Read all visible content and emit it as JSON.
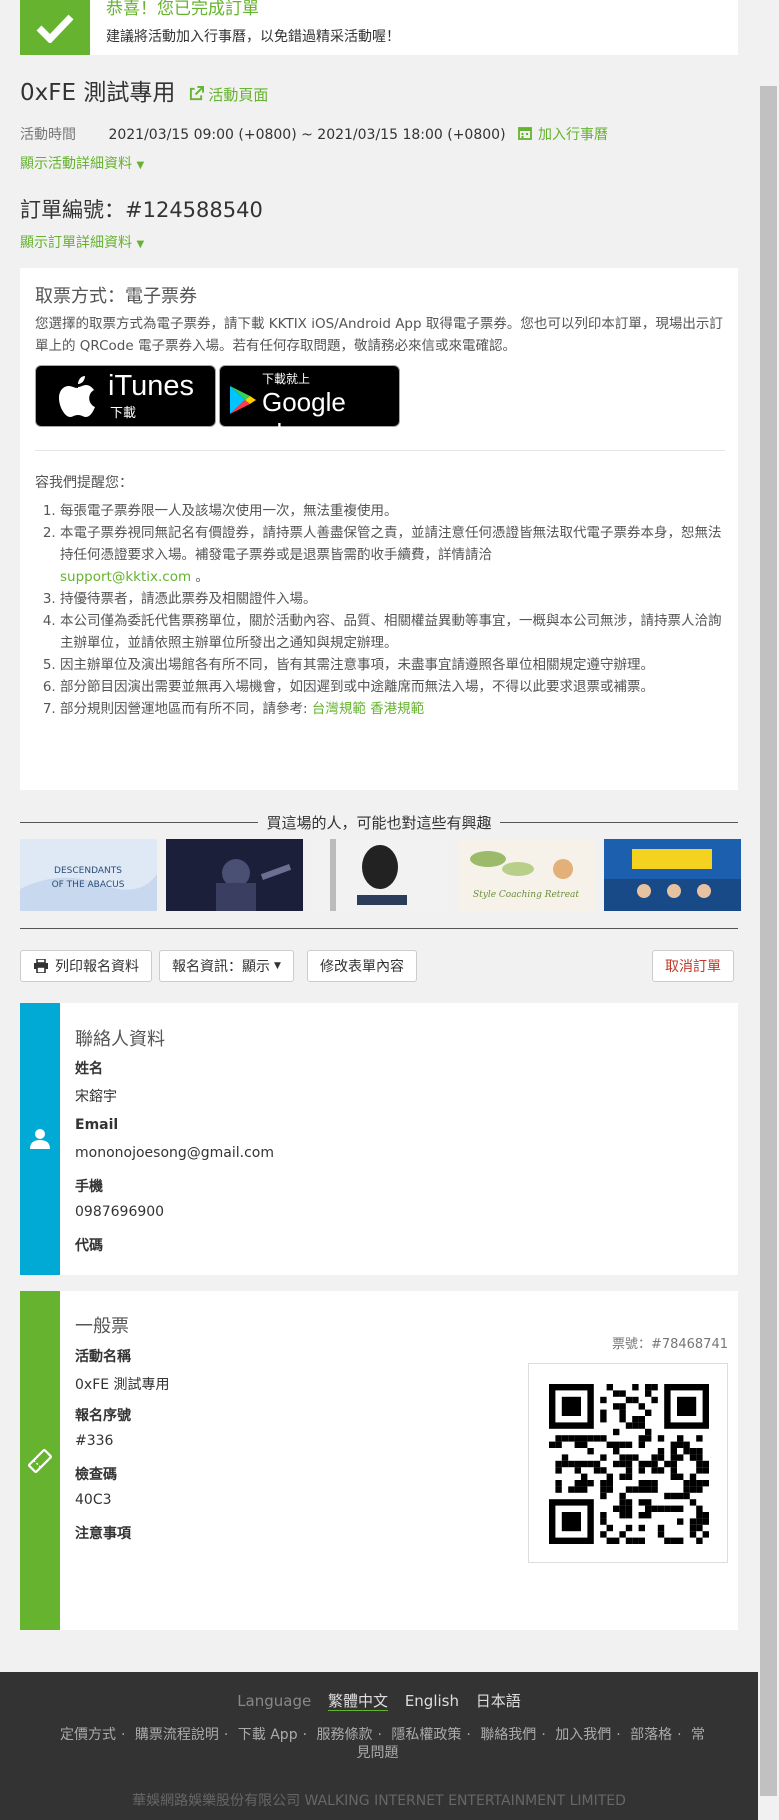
{
  "banner": {
    "title": "恭喜！您已完成訂單",
    "subtitle": "建議將活動加入行事曆，以免錯過精采活動喔！"
  },
  "event": {
    "title": "0xFE 測試專用",
    "page_link": "活動頁面",
    "time_label": "活動時間",
    "time_value": "2021/03/15 09:00 (+0800) ~ 2021/03/15 18:00 (+0800)",
    "add_calendar": "加入行事曆",
    "show_details": "顯示活動詳細資料"
  },
  "order": {
    "number": "訂單編號：#124588540",
    "show_details": "顯示訂單詳細資料"
  },
  "ticket_method": {
    "title": "取票方式：電子票券",
    "description": "您選擇的取票方式為電子票券，請下載 KKTIX iOS/Android App 取得電子票券。您也可以列印本訂單，現場出示訂單上的 QRCode 電子票券入場。若有任何存取問題，敬請務必來信或來電確認。",
    "itunes_big": "iTunes",
    "itunes_small": "下載",
    "gplay_small": "下載就上",
    "gplay_big": "Google play",
    "remind_title": "容我們提醒您：",
    "rules": [
      "每張電子票券限一人及該場次使用一次，無法重複使用。",
      "本電子票券視同無記名有價證券，請持票人善盡保管之責，並請注意任何憑證皆無法取代電子票券本身，恕無法持任何憑證要求入場。補發電子票券或是退票皆需酌收手續費，詳情請洽",
      "持優待票者，請憑此票券及相關證件入場。",
      "本公司僅為委託代售票務單位，關於活動內容、品質、相關權益異動等事宜，一概與本公司無涉，請持票人洽詢主辦單位，並請依照主辦單位所發出之通知與規定辦理。",
      "因主辦單位及演出場館各有所不同，皆有其需注意事項，未盡事宜請遵照各單位相關規定遵守辦理。",
      "部分節目因演出需要並無再入場機會，如因遲到或中途離席而無法入場，不得以此要求退票或補票。",
      "部分規則因營運地區而有所不同，請參考:"
    ],
    "support_email": "support@kktix.com",
    "rule_tw": "台灣規範",
    "rule_hk": "香港規範"
  },
  "interest_title": "買這場的人，可能也對這些有興趣",
  "thumbs": [
    {
      "name": "DESCENDANTS OF THE ABACUS",
      "bg": "#dfe9f5"
    },
    {
      "name": "concert",
      "bg": "#1b1f3a"
    },
    {
      "name": "book",
      "bg": "#f2f2f2"
    },
    {
      "name": "Style Coaching Retreat",
      "bg": "#f6f2ea"
    },
    {
      "name": "seminar",
      "bg": "#1b5fae"
    }
  ],
  "thumb_texts": {
    "t1a": "DESCENDANTS",
    "t1b": "OF THE ABACUS",
    "t4": "Style Coaching Retreat"
  },
  "actions": {
    "print": "列印報名資料",
    "reg_info": "報名資訊：顯示",
    "edit_form": "修改表單內容",
    "cancel": "取消訂單"
  },
  "contact": {
    "title": "聯絡人資料",
    "name_label": "姓名",
    "name_value": "宋鎔宇",
    "email_label": "Email",
    "email_value": "mononojoesong@gmail.com",
    "phone_label": "手機",
    "phone_value": "0987696900",
    "code_label": "代碼"
  },
  "ticket": {
    "title": "一般票",
    "ticket_no": "票號：#78468741",
    "event_label": "活動名稱",
    "event_value": "0xFE 測試專用",
    "serial_label": "報名序號",
    "serial_value": "#336",
    "check_label": "檢查碼",
    "check_value": "40C3",
    "notes_label": "注意事項"
  },
  "footer": {
    "language_label": "Language",
    "lang_current": "繁體中文",
    "lang_en": "English",
    "lang_ja": "日本語",
    "links": [
      "定價方式",
      "購票流程說明",
      "下載 App",
      "服務條款",
      "隱私權政策",
      "聯絡我們",
      "加入我們",
      "部落格",
      "常見問題"
    ],
    "copyright": "華娛網路娛樂股份有限公司 WALKING INTERNET ENTERTAINMENT LIMITED"
  },
  "colors": {
    "accent": "#65b32e",
    "contact_side": "#00aad4",
    "ticket_side": "#65b32e",
    "footer_bg": "#333333"
  }
}
